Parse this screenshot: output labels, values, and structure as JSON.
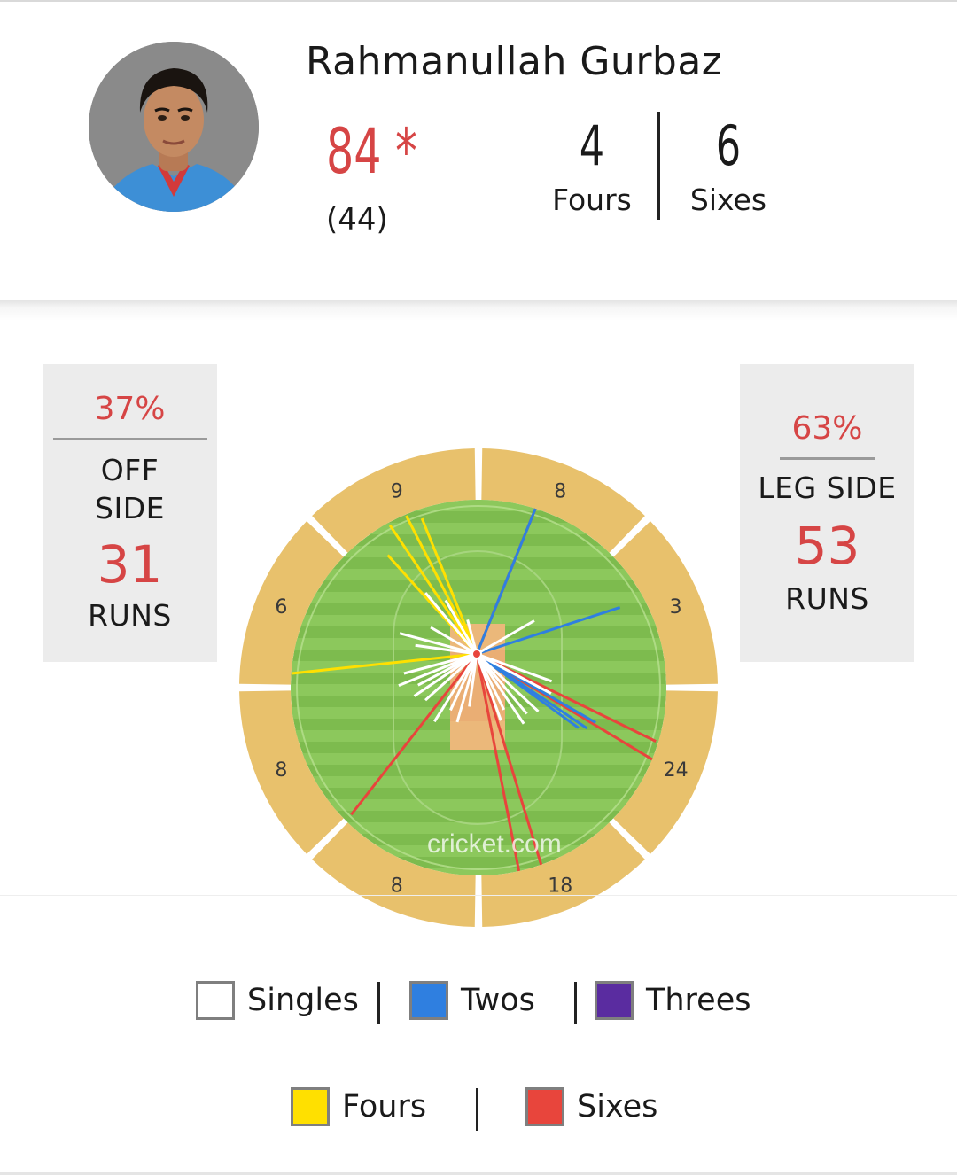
{
  "player": {
    "name": "Rahmanullah Gurbaz",
    "score": "84 *",
    "balls": "(44)",
    "fours": "4",
    "fours_label": "Fours",
    "sixes": "6",
    "sixes_label": "Sixes"
  },
  "off_side": {
    "percent": "37%",
    "label_line1": "OFF",
    "label_line2": "SIDE",
    "runs": "31",
    "runs_label": "RUNS"
  },
  "leg_side": {
    "percent": "63%",
    "label": "LEG SIDE",
    "runs": "53",
    "runs_label": "RUNS"
  },
  "wagon_wheel": {
    "zones": [
      {
        "zone": "top-left",
        "runs": "9"
      },
      {
        "zone": "top-right",
        "runs": "8"
      },
      {
        "zone": "right-upper",
        "runs": "3"
      },
      {
        "zone": "right-lower",
        "runs": "24"
      },
      {
        "zone": "bottom-right",
        "runs": "18"
      },
      {
        "zone": "bottom-left",
        "runs": "8"
      },
      {
        "zone": "left-lower",
        "runs": "8"
      },
      {
        "zone": "left-upper",
        "runs": "6"
      }
    ],
    "watermark": "cricket.com",
    "colors": {
      "boundary": "#e8c16c",
      "grass_light": "#8cc85c",
      "grass_dark": "#7dbb4e",
      "pitch": "#ebb87a",
      "singles": "#ffffff",
      "twos": "#2f7fe0",
      "threes": "#5a2ca0",
      "fours": "#ffe000",
      "sixes": "#e8453c"
    }
  },
  "legend": {
    "singles": "Singles",
    "twos": "Twos",
    "threes": "Threes",
    "fours": "Fours",
    "sixes": "Sixes"
  }
}
